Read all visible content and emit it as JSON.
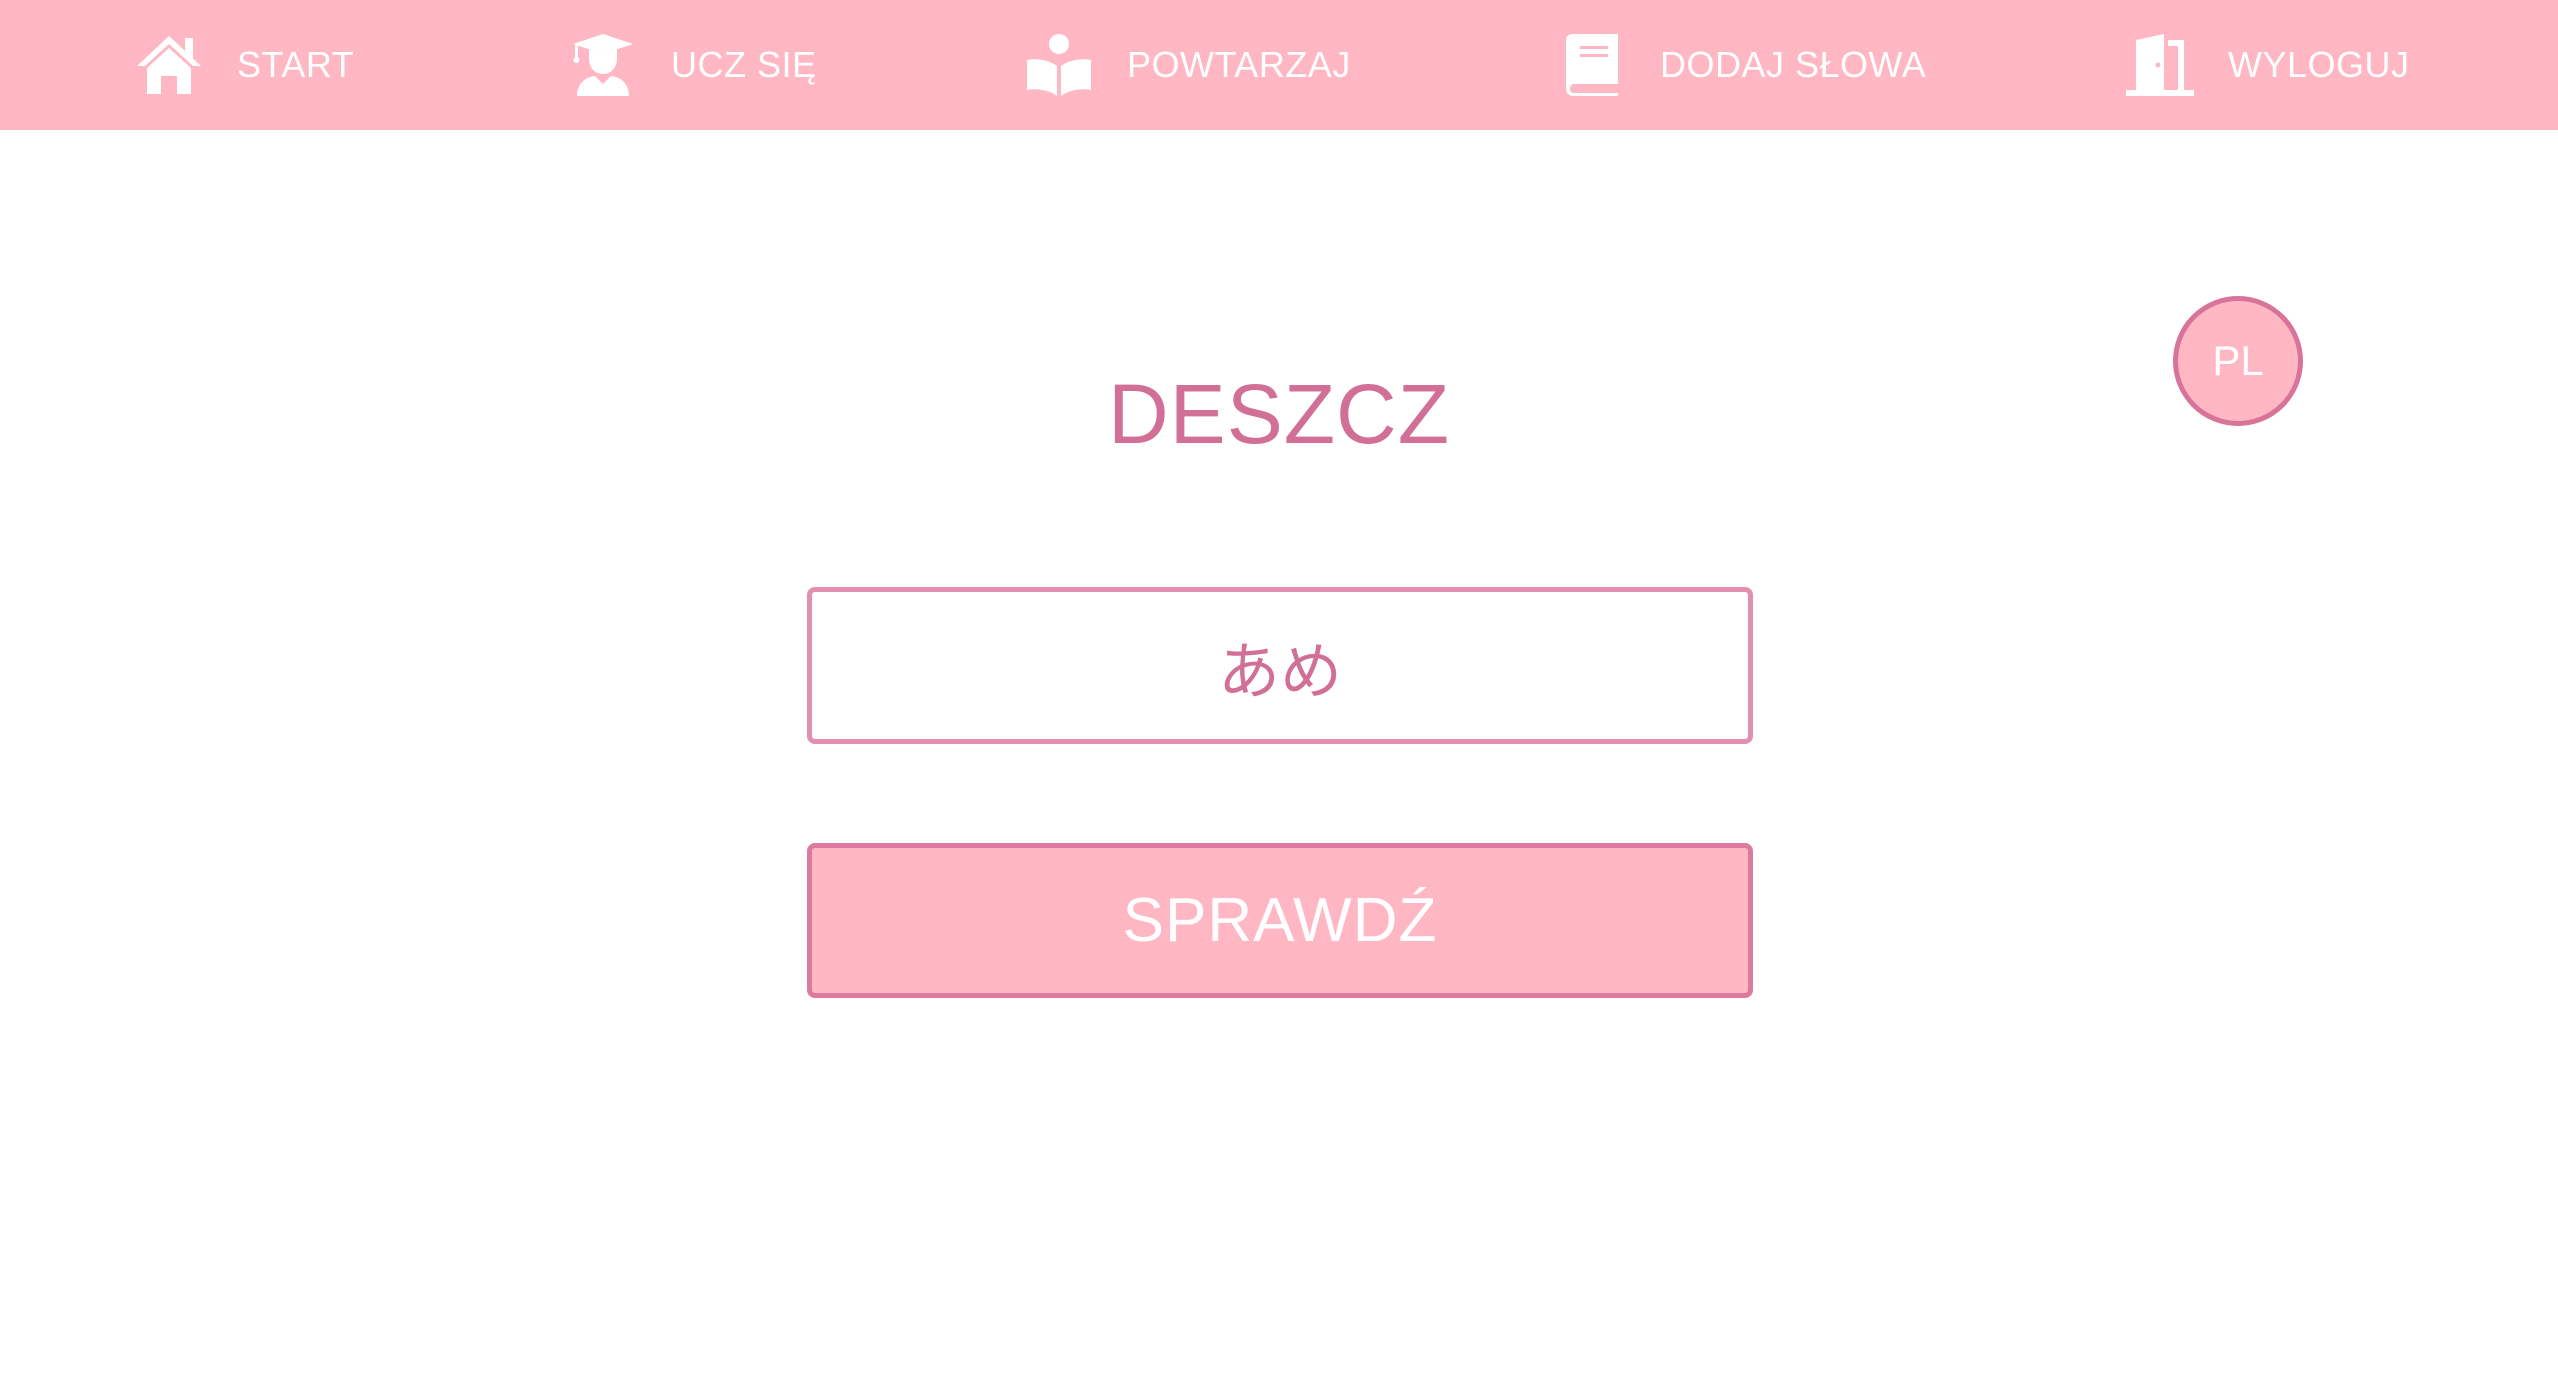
{
  "nav": {
    "items": [
      {
        "label": "START",
        "icon": "home-icon"
      },
      {
        "label": "UCZ SIĘ",
        "icon": "graduate-icon"
      },
      {
        "label": "POWTARZAJ",
        "icon": "reader-icon"
      },
      {
        "label": "DODAJ SŁOWA",
        "icon": "book-icon"
      },
      {
        "label": "WYLOGUJ",
        "icon": "door-icon"
      }
    ]
  },
  "language_badge": "PL",
  "quiz": {
    "word": "DESZCZ",
    "answer_value": "あめ",
    "check_label": "SPRAWDŹ"
  },
  "colors": {
    "primary": "#ffb7c4",
    "accent": "#d16f96",
    "input_border": "#e18fb0",
    "text_on_primary": "#ffffff"
  }
}
